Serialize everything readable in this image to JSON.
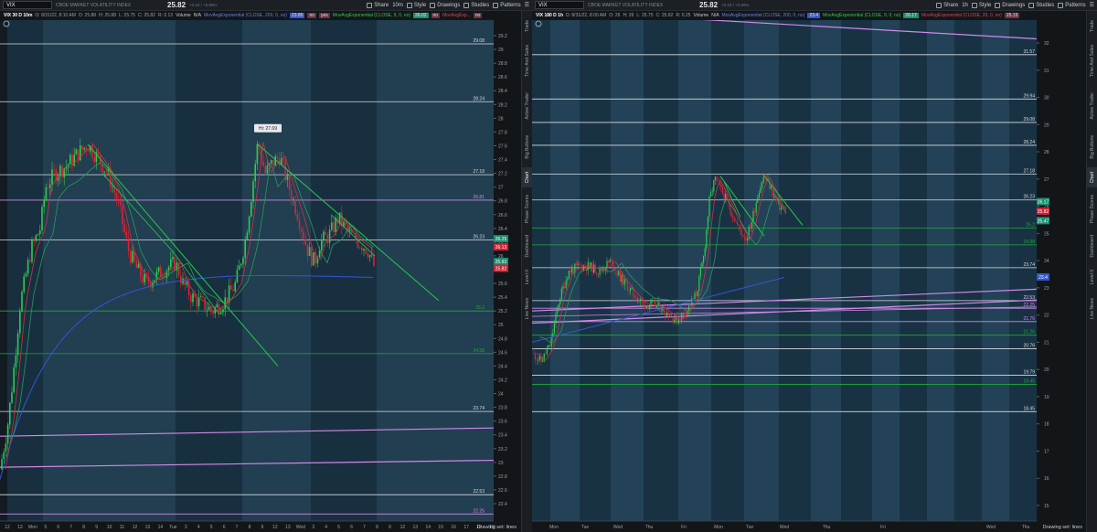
{
  "left": {
    "toolbar": {
      "symbol": "VIX",
      "description": "CBOE MARKET VOLATILITY INDEX",
      "price": "25.82",
      "change": "+0.23 / +0.89%",
      "buttons": [
        "Share",
        "10m",
        "Style",
        "Drawings",
        "Studies",
        "Patterns"
      ]
    },
    "header": {
      "title": "VIX 30 D 10m",
      "stats": [
        "O: 8/31/22, 8:10 AM",
        "O: 25.88",
        "H: 25.88",
        "L: 25.75",
        "C: 25.82",
        "R: 0.13"
      ],
      "volume_label": "Volume",
      "volume_value": "N/A",
      "ma1": "MovAvgExponential (CLOSE, 200, 0, no)",
      "ma1_value": "23.85",
      "ma1_flag": "no",
      "ma1_flag2": "yes",
      "ma2": "MovAvgExponential (CLOSE, 9, 0, no)",
      "ma2_value": "26.02",
      "ma2_flag": "no",
      "ma3": "MovAvgExp...",
      "ma3_value": "no"
    },
    "hi_label": "Hi: 27.69",
    "x_axis": [
      "12",
      "13",
      "Mon",
      "5",
      "6",
      "7",
      "8",
      "9",
      "10",
      "11",
      "12",
      "13",
      "14",
      "Tue",
      "3",
      "4",
      "5",
      "6",
      "7",
      "8",
      "9",
      "12",
      "13",
      "Wed",
      "3",
      "4",
      "5",
      "6",
      "7",
      "8",
      "9",
      "12",
      "13",
      "14",
      "15",
      "16",
      "17",
      "18",
      "19"
    ],
    "y_ticks": [
      "29.2",
      "29",
      "28.8",
      "28.6",
      "28.4",
      "28.2",
      "28",
      "27.8",
      "27.6",
      "27.4",
      "27.2",
      "27",
      "26.8",
      "26.6",
      "26.4",
      "26.2",
      "26",
      "25.8",
      "25.6",
      "25.4",
      "25.2",
      "25",
      "24.8",
      "24.6",
      "24.4",
      "24.2",
      "24",
      "23.8",
      "23.6",
      "23.4",
      "23.2",
      "23",
      "22.8",
      "22.6",
      "22.4"
    ],
    "levels": [
      {
        "label": "29.08",
        "color": "white"
      },
      {
        "label": "28.24",
        "color": "white"
      },
      {
        "label": "27.18",
        "color": "white"
      },
      {
        "label": "26.81",
        "color": "violet"
      },
      {
        "label": "26.23",
        "color": "white"
      },
      {
        "label": "25.2",
        "color": "green"
      },
      {
        "label": "24.58",
        "color": "green"
      },
      {
        "label": "23.74",
        "color": "white"
      },
      {
        "label": "22.53",
        "color": "white"
      },
      {
        "label": "22.25",
        "color": "violet"
      }
    ],
    "badges": [
      {
        "label": "26.25",
        "color": "#1a8f6f"
      },
      {
        "label": "26.13",
        "color": "#cc2233"
      },
      {
        "label": "25.92",
        "color": "#1a8f6f"
      },
      {
        "label": "25.82",
        "color": "#cc2233"
      }
    ],
    "footer": "Drawing set: lines"
  },
  "right": {
    "toolbar": {
      "symbol": "VIX",
      "description": "CBOE MARKET VOLATILITY INDEX",
      "price": "25.82",
      "change": "+0.23 / +0.89%",
      "buttons": [
        "Share",
        "1h",
        "Style",
        "Drawings",
        "Studies",
        "Patterns"
      ]
    },
    "header": {
      "title": "VIX 180 D 1h",
      "stats": [
        "D: 8/31/22, 8:00 AM",
        "O: 26",
        "H: 26",
        "L: 25.75",
        "C: 25.82",
        "R: 0.25"
      ],
      "volume_label": "Volume",
      "volume_value": "N/A",
      "ma1": "MovAvgExponential (CLOSE, 200, 0, no)",
      "ma1_value": "23.4",
      "ma2": "MovAvgExponential (CLOSE, 9, 0, no)",
      "ma2_value": "26.17",
      "ma3": "MovAvgExponential (CLOSE, 20, 0, no)",
      "ma3_value": "25.15"
    },
    "x_axis": [
      "Mon",
      "Tue",
      "Wed",
      "Thu",
      "Fri",
      "Mon",
      "Tue",
      "Wed",
      "Thu",
      "Fri",
      "Wed",
      "Thu"
    ],
    "y_ticks": [
      "32",
      "31",
      "30",
      "29",
      "28",
      "27",
      "26",
      "25",
      "24",
      "23",
      "22",
      "21",
      "20",
      "19",
      "18",
      "17",
      "16",
      "15"
    ],
    "levels": [
      {
        "label": "31.57",
        "color": "white"
      },
      {
        "label": "29.94",
        "color": "white"
      },
      {
        "label": "29.08",
        "color": "white"
      },
      {
        "label": "28.24",
        "color": "white"
      },
      {
        "label": "27.18",
        "color": "white"
      },
      {
        "label": "26.23",
        "color": "white"
      },
      {
        "label": "25.2",
        "color": "green"
      },
      {
        "label": "24.58",
        "color": "green"
      },
      {
        "label": "23.74",
        "color": "white"
      },
      {
        "label": "22.53",
        "color": "white"
      },
      {
        "label": "22.25",
        "color": "violet"
      },
      {
        "label": "21.76",
        "color": "violet"
      },
      {
        "label": "21.26",
        "color": "green"
      },
      {
        "label": "20.76",
        "color": "white"
      },
      {
        "label": "19.79",
        "color": "white"
      },
      {
        "label": "19.45",
        "color": "green"
      },
      {
        "label": "18.45",
        "color": "white"
      }
    ],
    "badges": [
      {
        "label": "26.17",
        "color": "#1a8f6f"
      },
      {
        "label": "25.82",
        "color": "#cc2233"
      },
      {
        "label": "25.47",
        "color": "#1a8f6f"
      },
      {
        "label": "23.4",
        "color": "#3355cc"
      }
    ],
    "footer": "Drawing set: lines"
  },
  "sidebar": [
    "Trade",
    "Time And Sales",
    "Active Trader",
    "Big Buttons",
    "Chart",
    "Phase Scores",
    "Dashboard",
    "Level II",
    "Live News"
  ],
  "colors": {
    "bg": "#131619",
    "band": "#1f4a66",
    "up": "#2fcc4a",
    "down": "#dd2233",
    "trend": "#22cc44",
    "violet": "#d08ae8",
    "white_level": "#d8dce0",
    "green_level": "#1faa3a",
    "ma_blue": "#3355dd",
    "ma_green": "#2a9a5a",
    "ma_red": "#cc3344"
  }
}
